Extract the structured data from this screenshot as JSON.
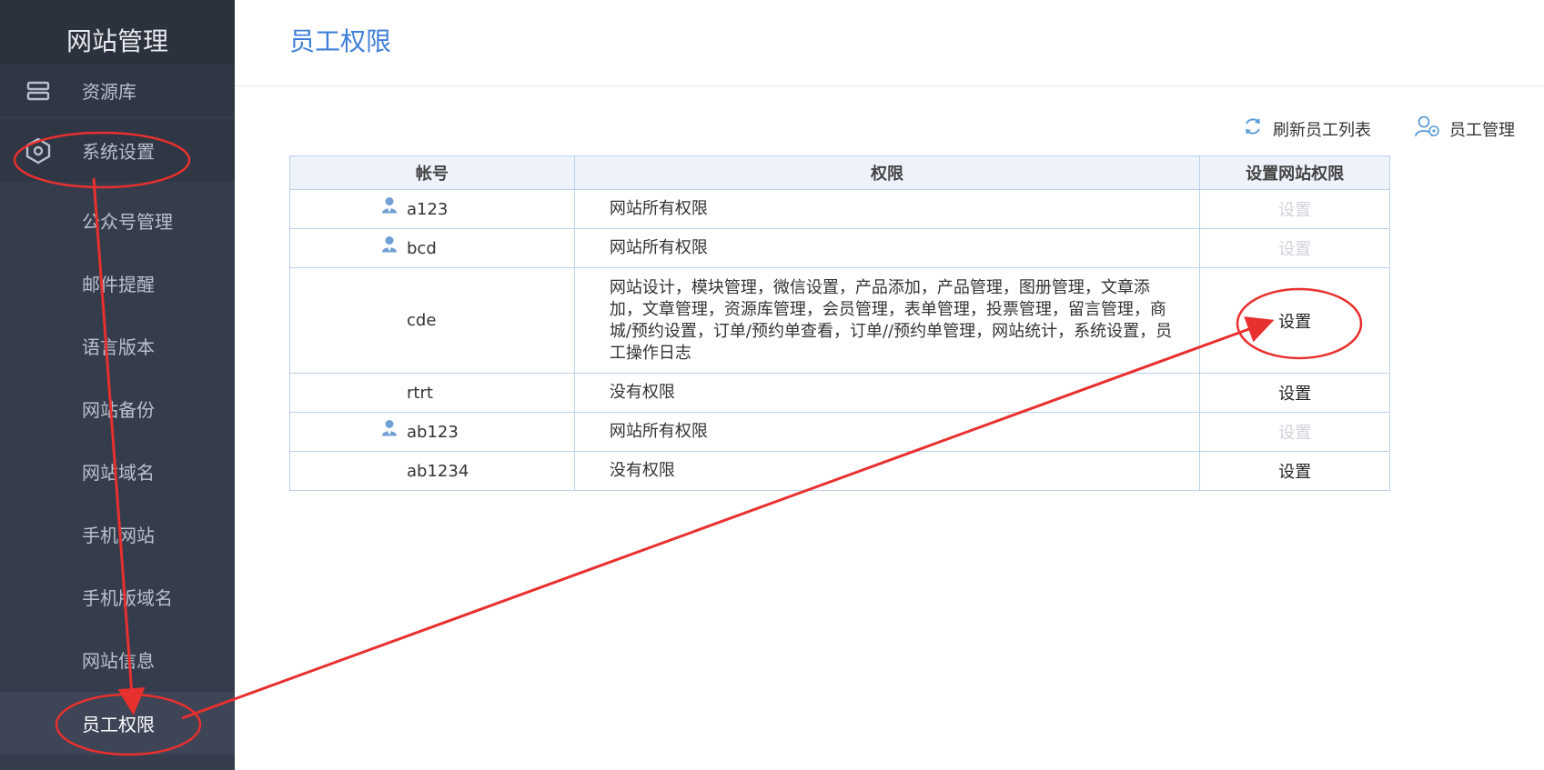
{
  "sidebar": {
    "brand": "网站管理",
    "items": [
      {
        "label": "资源库",
        "icon": "server-icon"
      },
      {
        "label": "系统设置",
        "icon": "gear-hex-icon"
      },
      {
        "label": "公众号管理"
      },
      {
        "label": "邮件提醒"
      },
      {
        "label": "语言版本"
      },
      {
        "label": "网站备份"
      },
      {
        "label": "网站域名"
      },
      {
        "label": "手机网站"
      },
      {
        "label": "手机版域名"
      },
      {
        "label": "网站信息"
      },
      {
        "label": "员工权限"
      }
    ]
  },
  "main": {
    "title": "员工权限",
    "toolbar": {
      "refresh_label": "刷新员工列表",
      "manage_label": "员工管理"
    },
    "table": {
      "headers": [
        "帐号",
        "权限",
        "设置网站权限"
      ],
      "rows": [
        {
          "account": "a123",
          "has_icon": true,
          "permission": "网站所有权限",
          "action": "设置",
          "enabled": false
        },
        {
          "account": "bcd",
          "has_icon": true,
          "permission": "网站所有权限",
          "action": "设置",
          "enabled": false
        },
        {
          "account": "cde",
          "has_icon": false,
          "permission": "网站设计，模块管理，微信设置，产品添加，产品管理，图册管理，文章添加，文章管理，资源库管理，会员管理，表单管理，投票管理，留言管理，商城/预约设置，订单/预约单查看，订单//预约单管理，网站统计，系统设置，员工操作日志",
          "action": "设置",
          "enabled": true
        },
        {
          "account": "rtrt",
          "has_icon": false,
          "permission": "没有权限",
          "action": "设置",
          "enabled": true
        },
        {
          "account": "ab123",
          "has_icon": true,
          "permission": "网站所有权限",
          "action": "设置",
          "enabled": false
        },
        {
          "account": "ab1234",
          "has_icon": false,
          "permission": "没有权限",
          "action": "设置",
          "enabled": true
        }
      ]
    }
  },
  "colors": {
    "sidebar_bg": "#353d4d",
    "accent": "#3f7fd8",
    "annotation": "#e8302e"
  }
}
